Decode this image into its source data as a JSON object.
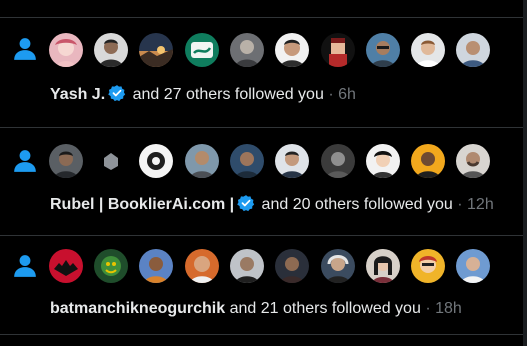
{
  "colors": {
    "background": "#000000",
    "divider": "#2f3336",
    "accent_blue": "#1d9bf0",
    "text_primary": "#e7e9ea",
    "text_secondary": "#71767b"
  },
  "notifications": [
    {
      "icon": "person-icon",
      "name": "Yash J.",
      "verified": true,
      "text": "and 27 others followed you",
      "separator": "·",
      "time": "6h",
      "avatar_count": 10
    },
    {
      "icon": "person-icon",
      "name": "Rubel | BooklierAi.com |",
      "verified": true,
      "text": "and 20 others followed you",
      "separator": "·",
      "time": "12h",
      "avatar_count": 10
    },
    {
      "icon": "person-icon",
      "name": "batmanchikneogurchik",
      "verified": false,
      "text": "and 21 others followed you",
      "separator": "·",
      "time": "18h",
      "avatar_count": 10
    }
  ]
}
